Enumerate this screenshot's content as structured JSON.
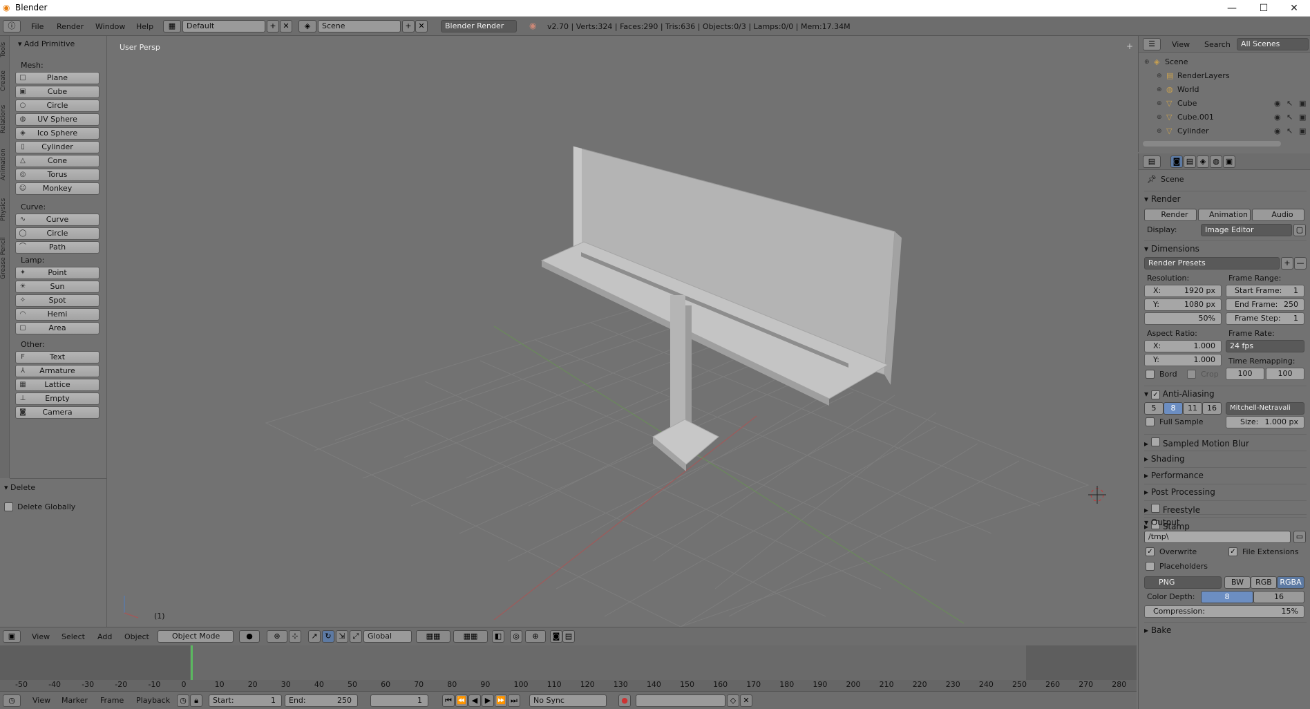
{
  "window": {
    "title": "Blender",
    "minimize": "—",
    "maximize": "☐",
    "close": "✕"
  },
  "topbar": {
    "menus": [
      "File",
      "Render",
      "Window",
      "Help"
    ],
    "layout": "Default",
    "scene": "Scene",
    "engine": "Blender Render",
    "stats": "v2.70 | Verts:324 | Faces:290 | Tris:636 | Objects:0/3 | Lamps:0/0 | Mem:17.34M"
  },
  "toolshelf": {
    "tabs": [
      "Tools",
      "Create",
      "Relations",
      "Animation",
      "Physics",
      "Grease Pencil"
    ],
    "panel_title": "Add Primitive",
    "mesh_label": "Mesh:",
    "mesh": [
      {
        "label": "Plane",
        "icon": "□"
      },
      {
        "label": "Cube",
        "icon": "▣"
      },
      {
        "label": "Circle",
        "icon": "○"
      },
      {
        "label": "UV Sphere",
        "icon": "◍"
      },
      {
        "label": "Ico Sphere",
        "icon": "◈"
      },
      {
        "label": "Cylinder",
        "icon": "▯"
      },
      {
        "label": "Cone",
        "icon": "△"
      },
      {
        "label": "Torus",
        "icon": "◎"
      },
      {
        "label": "Monkey",
        "icon": "☺"
      }
    ],
    "curve_label": "Curve:",
    "curve": [
      {
        "label": "Curve",
        "icon": "∿"
      },
      {
        "label": "Circle",
        "icon": "◯"
      },
      {
        "label": "Path",
        "icon": "⌒"
      }
    ],
    "lamp_label": "Lamp:",
    "lamp": [
      {
        "label": "Point",
        "icon": "✦"
      },
      {
        "label": "Sun",
        "icon": "☀"
      },
      {
        "label": "Spot",
        "icon": "✧"
      },
      {
        "label": "Hemi",
        "icon": "◠"
      },
      {
        "label": "Area",
        "icon": "▢"
      }
    ],
    "other_label": "Other:",
    "other": [
      {
        "label": "Text",
        "icon": "F"
      },
      {
        "label": "Armature",
        "icon": "⅄"
      },
      {
        "label": "Lattice",
        "icon": "▦"
      },
      {
        "label": "Empty",
        "icon": "⊥"
      },
      {
        "label": "Camera",
        "icon": "◙"
      }
    ],
    "delete_title": "Delete",
    "delete_globally": "Delete Globally"
  },
  "viewport": {
    "view_label": "User Persp",
    "frame_label": "(1)"
  },
  "vp_header": {
    "menus": [
      "View",
      "Select",
      "Add",
      "Object"
    ],
    "mode": "Object Mode",
    "orientation": "Global"
  },
  "timeline": {
    "ticks": [
      "-50",
      "-40",
      "-30",
      "-20",
      "-10",
      "0",
      "10",
      "20",
      "30",
      "40",
      "50",
      "60",
      "70",
      "80",
      "90",
      "100",
      "110",
      "120",
      "130",
      "140",
      "150",
      "160",
      "170",
      "180",
      "190",
      "200",
      "210",
      "220",
      "230",
      "240",
      "250",
      "260",
      "270",
      "280"
    ],
    "current_frame": 1
  },
  "tl_header": {
    "menus": [
      "View",
      "Marker",
      "Frame",
      "Playback"
    ],
    "start_label": "Start:",
    "start": "1",
    "end_label": "End:",
    "end": "250",
    "frame": "1",
    "sync": "No Sync"
  },
  "outliner": {
    "menus": [
      "View",
      "Search"
    ],
    "filter": "All Scenes",
    "rows": [
      {
        "label": "Scene",
        "indent": 0
      },
      {
        "label": "RenderLayers",
        "indent": 1
      },
      {
        "label": "World",
        "indent": 1
      },
      {
        "label": "Cube",
        "indent": 1
      },
      {
        "label": "Cube.001",
        "indent": 1
      },
      {
        "label": "Cylinder",
        "indent": 1
      }
    ]
  },
  "props": {
    "context": "Scene",
    "render_title": "Render",
    "render_btn": "Render",
    "animation_btn": "Animation",
    "audio_btn": "Audio",
    "display_label": "Display:",
    "display": "Image Editor",
    "dimensions_title": "Dimensions",
    "presets": "Render Presets",
    "resolution_label": "Resolution:",
    "res_x": "X:",
    "res_x_val": "1920 px",
    "res_y": "Y:",
    "res_y_val": "1080 px",
    "res_pct": "50%",
    "frame_range_label": "Frame Range:",
    "start_frame": "Start Frame:",
    "start_frame_val": "1",
    "end_frame": "End Frame:",
    "end_frame_val": "250",
    "frame_step": "Frame Step:",
    "frame_step_val": "1",
    "aspect_label": "Aspect Ratio:",
    "asp_x": "X:",
    "asp_x_val": "1.000",
    "asp_y": "Y:",
    "asp_y_val": "1.000",
    "frame_rate_label": "Frame Rate:",
    "frame_rate": "24 fps",
    "time_remap_label": "Time Remapping:",
    "remap_old": "100",
    "remap_new": "100",
    "bord": "Bord",
    "crop": "Crop",
    "aa_title": "Anti-Aliasing",
    "aa_samples": [
      "5",
      "8",
      "11",
      "16"
    ],
    "aa_filter": "Mitchell-Netravali",
    "full_sample": "Full Sample",
    "size_label": "Size:",
    "size_val": "1.000 px",
    "collapsed": [
      "Sampled Motion Blur",
      "Shading",
      "Performance",
      "Post Processing",
      "Freestyle",
      "Stamp"
    ],
    "output_title": "Output",
    "output_path": "/tmp\\",
    "overwrite": "Overwrite",
    "file_ext": "File Extensions",
    "placeholders": "Placeholders",
    "format": "PNG",
    "bw": "BW",
    "rgb": "RGB",
    "rgba": "RGBA",
    "color_depth_label": "Color Depth:",
    "depth_8": "8",
    "depth_16": "16",
    "compression_label": "Compression:",
    "compression_val": "15%",
    "bake_title": "Bake"
  }
}
